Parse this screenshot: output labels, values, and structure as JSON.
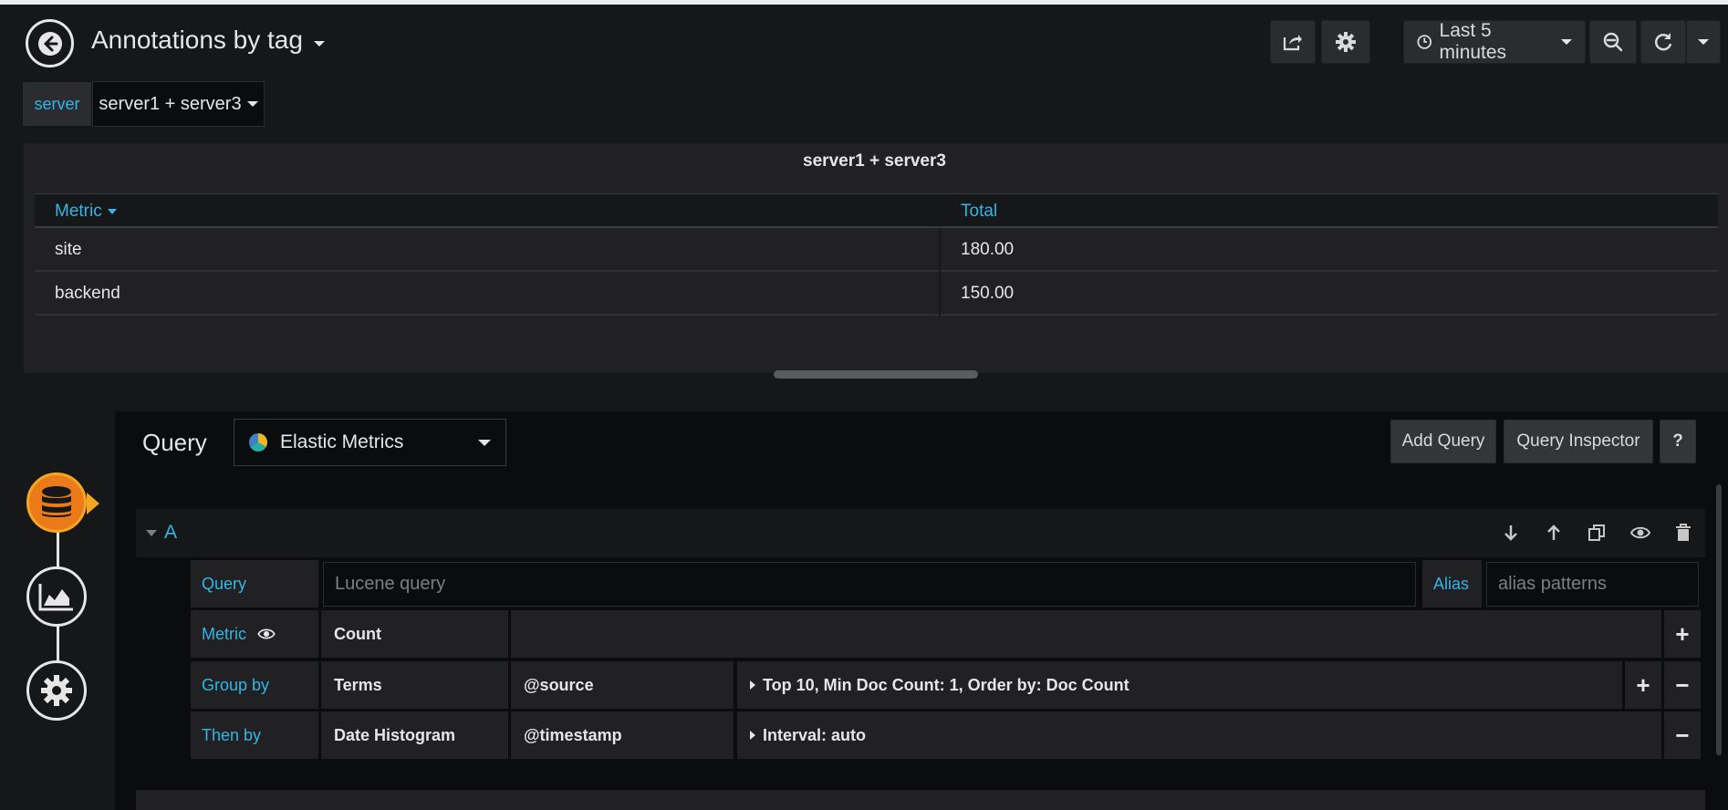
{
  "header": {
    "dashboard_title": "Annotations by tag",
    "time_range": "Last 5 minutes"
  },
  "variables": [
    {
      "label": "server",
      "value": "server1 + server3"
    }
  ],
  "panel": {
    "title": "server1 + server3",
    "columns": [
      "Metric",
      "Total"
    ],
    "rows": [
      [
        "site",
        "180.00"
      ],
      [
        "backend",
        "150.00"
      ]
    ]
  },
  "query_editor": {
    "title": "Query",
    "datasource": "Elastic Metrics",
    "add_query": "Add Query",
    "query_inspector": "Query Inspector",
    "help": "?",
    "ref_id": "A",
    "query_label": "Query",
    "query_placeholder": "Lucene query",
    "alias_label": "Alias",
    "alias_placeholder": "alias patterns",
    "metric_label": "Metric",
    "metric_type": "Count",
    "group_by_label": "Group by",
    "group_by_type": "Terms",
    "group_by_field": "@source",
    "group_by_options": "Top 10, Min Doc Count: 1, Order by: Doc Count",
    "then_by_label": "Then by",
    "then_by_type": "Date Histogram",
    "then_by_field": "@timestamp",
    "then_by_options": "Interval: auto"
  },
  "colors": {
    "accent_blue": "#33b5e5",
    "accent_orange": "#eb7b18",
    "background": "#161719"
  }
}
